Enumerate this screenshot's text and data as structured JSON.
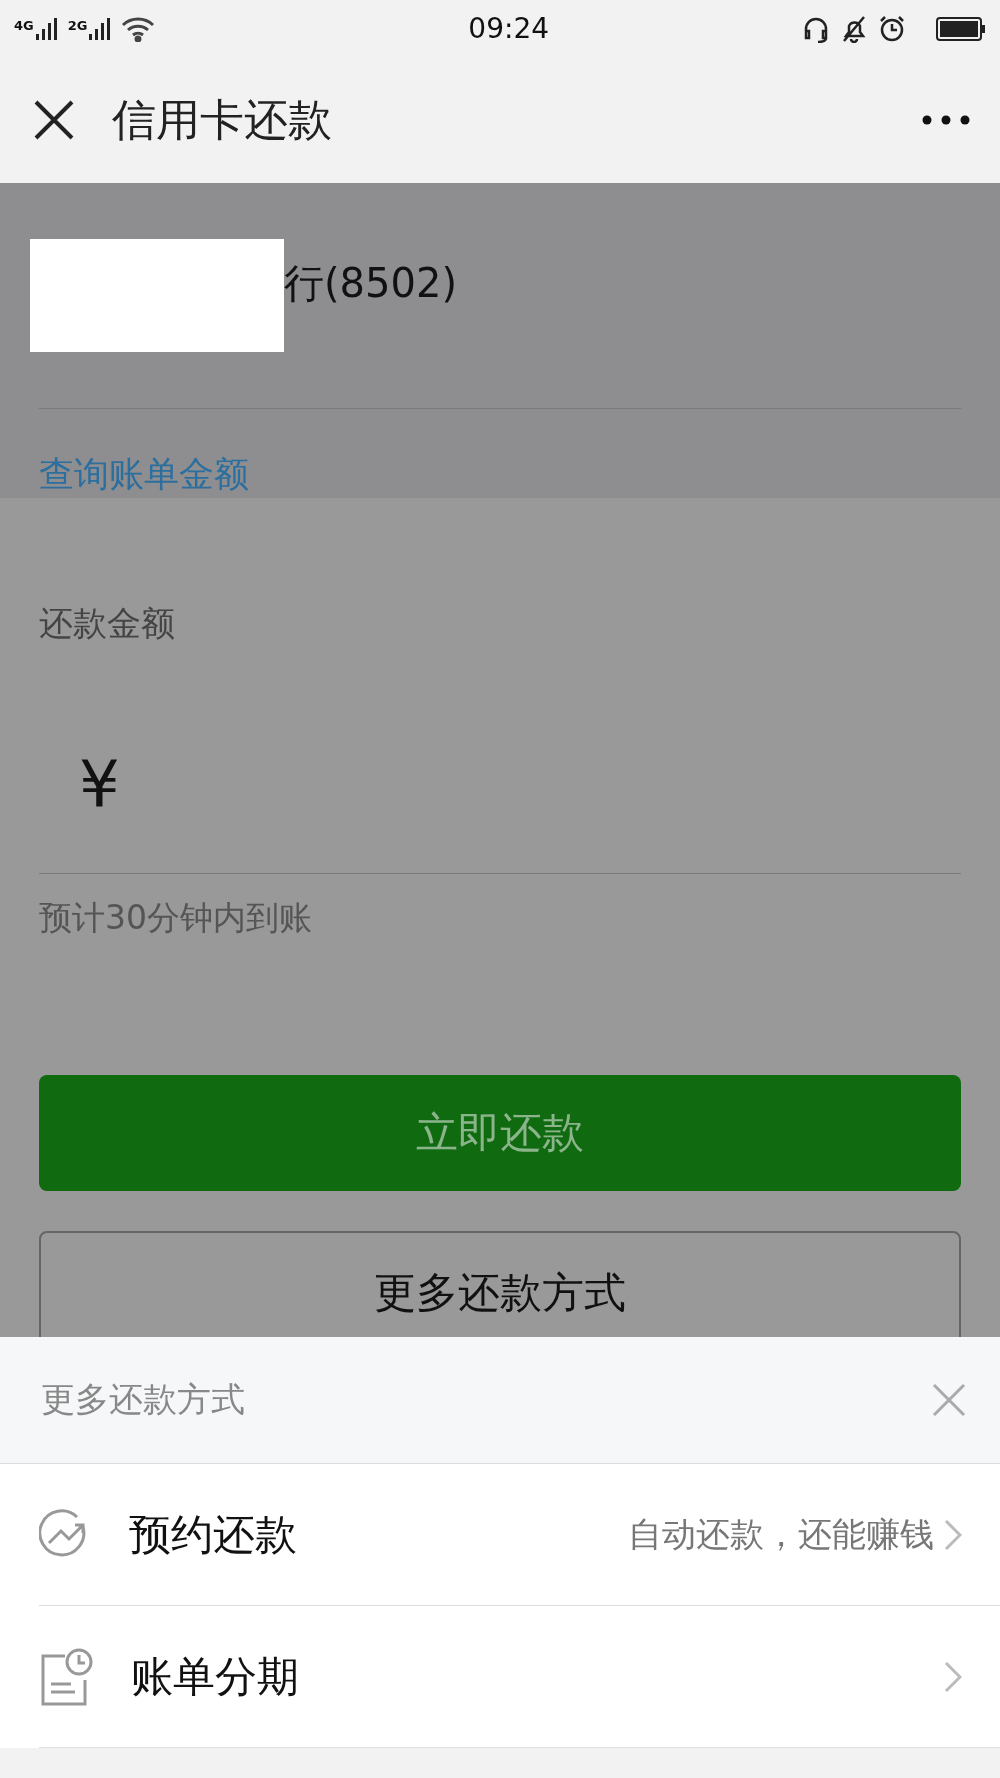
{
  "status_bar": {
    "network_1": "4G",
    "network_2": "2G",
    "time": "09:24"
  },
  "nav": {
    "title": "信用卡还款"
  },
  "card": {
    "bank": "行(8502)",
    "link": "查询账单金额"
  },
  "payment": {
    "label": "还款金额",
    "currency": "¥",
    "note": "预计30分钟内到账",
    "primary_button": "立即还款",
    "secondary_button": "更多还款方式"
  },
  "sheet": {
    "title": "更多还款方式",
    "items": [
      {
        "kind": "trend",
        "title": "预约还款",
        "subtitle": "自动还款，还能赚钱"
      },
      {
        "kind": "bill",
        "title": "账单分期"
      }
    ]
  }
}
